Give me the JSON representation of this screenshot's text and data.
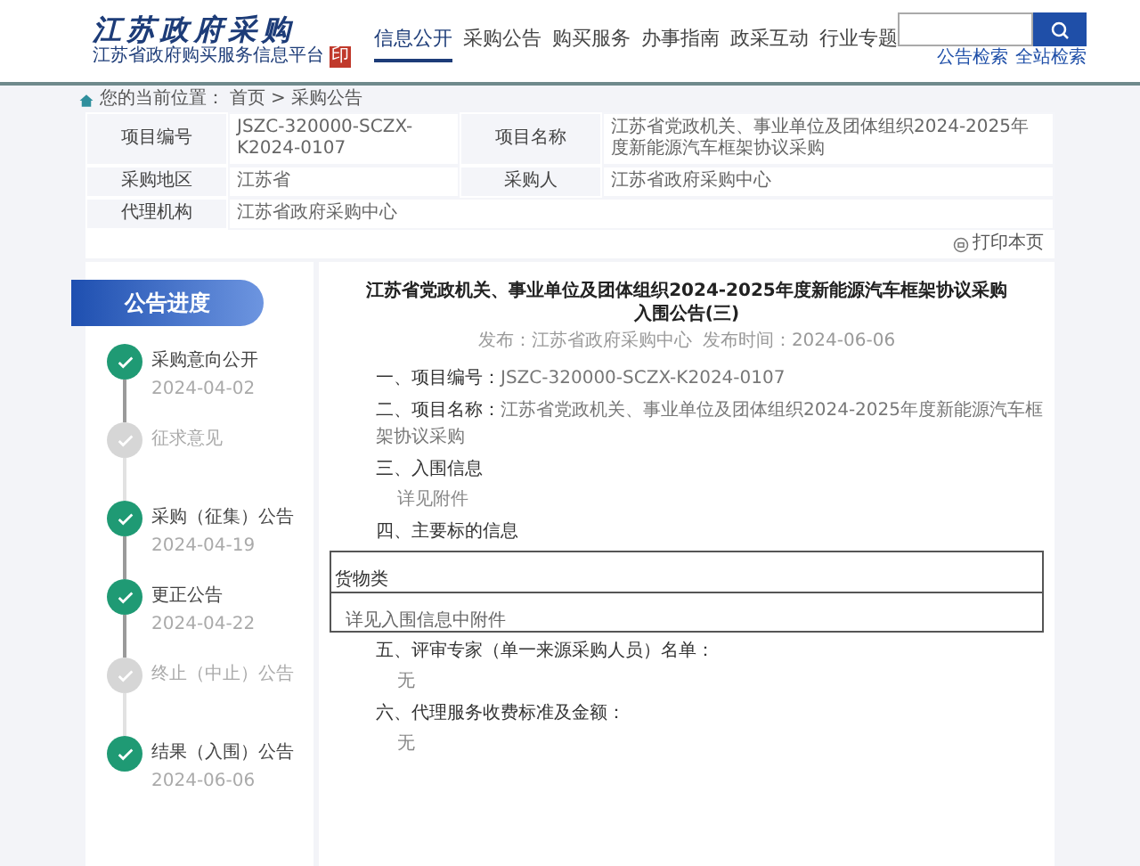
{
  "header": {
    "logo_title": "江苏政府采购",
    "logo_subtitle": "江苏省政府购买服务信息平台",
    "seal": "印"
  },
  "nav": [
    {
      "label": "信息公开",
      "selected": true
    },
    {
      "label": "采购公告",
      "selected": false
    },
    {
      "label": "购买服务",
      "selected": false
    },
    {
      "label": "办事指南",
      "selected": false
    },
    {
      "label": "政采互动",
      "selected": false
    },
    {
      "label": "行业专题",
      "selected": false
    }
  ],
  "search_links": [
    "公告检索",
    "全站检索"
  ],
  "breadcrumb": {
    "label": "您的当前位置：",
    "items": [
      "首页",
      "采购公告"
    ],
    "separator": ">"
  },
  "info_table": [
    [
      {
        "label": "项目编号",
        "value": "JSZC-320000-SCZX-K2024-0107"
      },
      {
        "label": "项目名称",
        "value": "江苏省党政机关、事业单位及团体组织2024-2025年度新能源汽车框架协议采购"
      }
    ],
    [
      {
        "label": "采购地区",
        "value": "江苏省"
      },
      {
        "label": "采购人",
        "value": "江苏省政府采购中心"
      }
    ],
    [
      {
        "label": "代理机构",
        "value": "江苏省政府采购中心"
      }
    ]
  ],
  "print_button": "打印本页",
  "sidebar": {
    "title": "公告进度",
    "steps": [
      {
        "label": "采购意向公开",
        "date": "2024-04-02",
        "done": true
      },
      {
        "label": "征求意见",
        "done": false
      },
      {
        "label": "采购（征集）公告",
        "date": "2024-04-19",
        "done": true
      },
      {
        "label": "更正公告",
        "date": "2024-04-22",
        "done": true
      },
      {
        "label": "终止（中止）公告",
        "done": false
      },
      {
        "label": "结果（入围）公告",
        "date": "2024-06-06",
        "done": true
      }
    ]
  },
  "article": {
    "title": "江苏省党政机关、事业单位及团体组织2024-2025年度新能源汽车框架协议采购入围公告(三)",
    "meta": [
      "发布：江苏省政府采购中心",
      "发布时间：2024-06-06"
    ],
    "blocks": [
      {
        "kind": "heading",
        "text": "一、项目编号：",
        "value": "JSZC-320000-SCZX-K2024-0107"
      },
      {
        "kind": "heading",
        "text": "二、项目名称：",
        "value": "江苏省党政机关、事业单位及团体组织2024-2025年度新能源汽车框架协议采购"
      },
      {
        "kind": "heading",
        "text": "三、入围信息"
      },
      {
        "kind": "text",
        "text": "详见附件"
      },
      {
        "kind": "heading",
        "text": "四、主要标的信息"
      },
      {
        "kind": "table",
        "rows": [
          "货物类",
          "详见入围信息中附件"
        ]
      },
      {
        "kind": "heading",
        "text": "五、评审专家（单一来源采购人员）名单："
      },
      {
        "kind": "text",
        "text": "无"
      },
      {
        "kind": "heading",
        "text": "六、代理服务收费标准及金额："
      },
      {
        "kind": "text",
        "text": "无"
      }
    ]
  }
}
